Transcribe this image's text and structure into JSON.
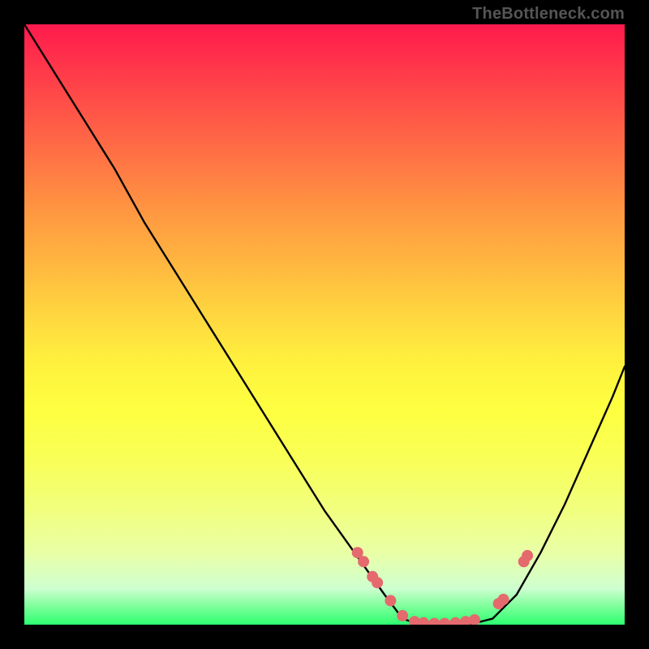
{
  "watermark": "TheBottleneck.com",
  "chart_data": {
    "type": "line",
    "title": "",
    "xlabel": "",
    "ylabel": "",
    "xlim": [
      0,
      1
    ],
    "ylim": [
      0,
      1
    ],
    "series": [
      {
        "name": "curve",
        "x": [
          0.0,
          0.05,
          0.1,
          0.15,
          0.2,
          0.25,
          0.3,
          0.35,
          0.4,
          0.45,
          0.5,
          0.55,
          0.6,
          0.63,
          0.66,
          0.7,
          0.74,
          0.78,
          0.82,
          0.86,
          0.9,
          0.94,
          0.98,
          1.0
        ],
        "y": [
          1.0,
          0.92,
          0.84,
          0.76,
          0.67,
          0.59,
          0.51,
          0.43,
          0.35,
          0.27,
          0.19,
          0.12,
          0.05,
          0.01,
          0.0,
          0.0,
          0.0,
          0.01,
          0.05,
          0.12,
          0.2,
          0.29,
          0.38,
          0.43
        ]
      }
    ],
    "highlight_points": {
      "name": "dots",
      "x": [
        0.555,
        0.565,
        0.58,
        0.588,
        0.61,
        0.63,
        0.65,
        0.665,
        0.683,
        0.7,
        0.718,
        0.735,
        0.75,
        0.79,
        0.798,
        0.832,
        0.838
      ],
      "y": [
        0.12,
        0.105,
        0.08,
        0.07,
        0.04,
        0.015,
        0.005,
        0.003,
        0.002,
        0.002,
        0.003,
        0.005,
        0.008,
        0.035,
        0.042,
        0.105,
        0.115
      ]
    },
    "colors": {
      "curve": "#000000",
      "dots": "#e46a6e",
      "gradient_top": "#ff1a4d",
      "gradient_bottom": "#2cff70"
    }
  }
}
